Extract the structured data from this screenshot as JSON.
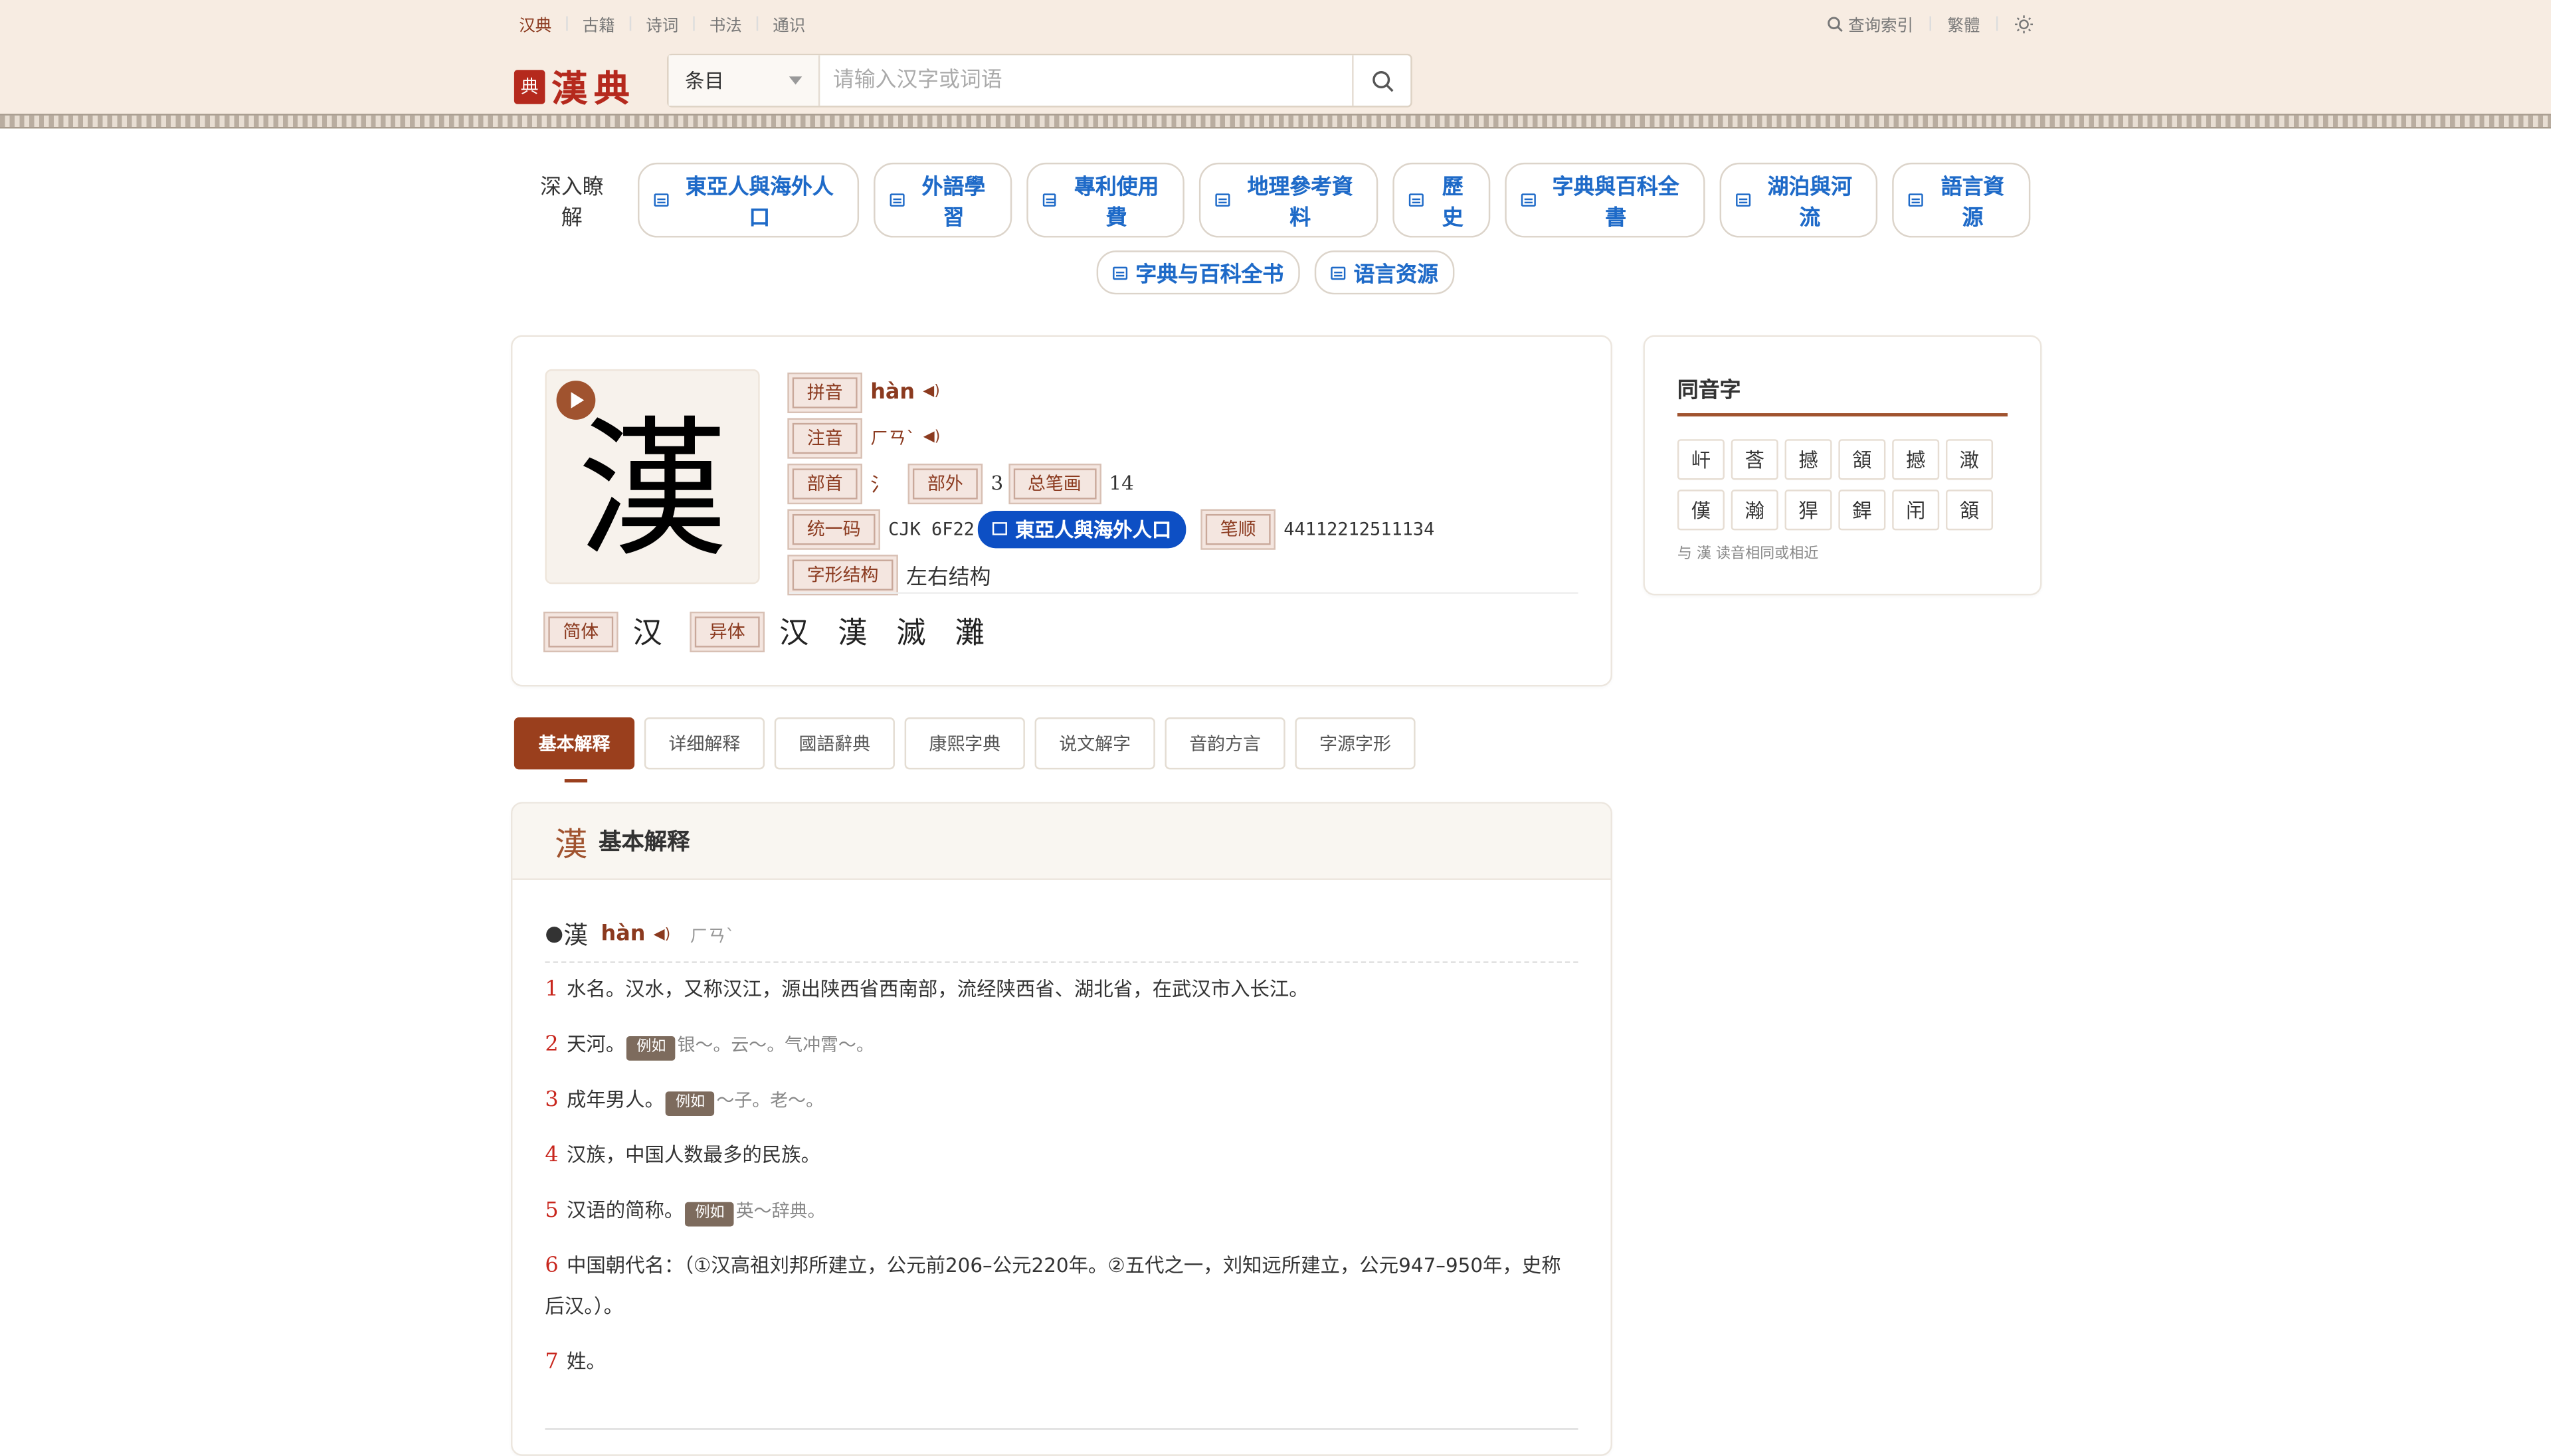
{
  "topnav": {
    "items": [
      {
        "label": "汉典"
      },
      {
        "label": "古籍"
      },
      {
        "label": "诗词"
      },
      {
        "label": "书法"
      },
      {
        "label": "通识"
      }
    ],
    "index_label": "查询索引",
    "trad_label": "繁體"
  },
  "logo": {
    "seal": "典",
    "text": "漢典"
  },
  "search": {
    "category": "条目",
    "placeholder": "请输入汉字或词语"
  },
  "explore": {
    "label": "深入瞭解",
    "tags": [
      "東亞人與海外人口",
      "外語學習",
      "專利使用費",
      "地理參考資料",
      "歷史",
      "字典與百科全書",
      "湖泊與河流",
      "語言資源"
    ],
    "tags2": [
      "字典与百科全书",
      "语言资源"
    ]
  },
  "char": {
    "glyph": "漢",
    "pinyin_label": "拼音",
    "pinyin": "hàn",
    "zhuyin_label": "注音",
    "zhuyin": "ㄏㄢˋ",
    "radical_label": "部首",
    "radical": "氵",
    "outer_label": "部外",
    "outer": "3",
    "strokes_label": "总笔画",
    "strokes": "14",
    "unicode_label": "统一码",
    "unicode": "CJK 6F22",
    "pill": "東亞人與海外人口",
    "order_label": "笔顺",
    "order": "44112212511134",
    "structure_label": "字形结构",
    "structure": "左右结构",
    "simplified_label": "简体",
    "simplified": "汉",
    "variant_label": "异体",
    "variants": [
      "汉",
      "漢",
      "滅",
      "灘"
    ]
  },
  "homophones": {
    "title": "同音字",
    "chars": [
      "屽",
      "莟",
      "撼",
      "頷",
      "撼",
      "澉",
      "傼",
      "瀚",
      "猂",
      "銲",
      "闬",
      "頷"
    ],
    "note": "与 漢 读音相同或相近"
  },
  "tabs": [
    "基本解释",
    "详细解释",
    "國語辭典",
    "康熙字典",
    "说文解字",
    "音韵方言",
    "字源字形"
  ],
  "basic": {
    "header_char": "漢",
    "header_title": "基本解释",
    "entry_char": "漢",
    "entry_pinyin": "hàn",
    "entry_zhuyin": "ㄏㄢˋ",
    "example_label": "例如",
    "defs": [
      {
        "num": "1",
        "text": "水名。汉水，又称汉江，源出陕西省西南部，流经陕西省、湖北省，在武汉市入长江。",
        "example": ""
      },
      {
        "num": "2",
        "text": "天河。",
        "example": "银～。云～。气冲霄～。"
      },
      {
        "num": "3",
        "text": "成年男人。",
        "example": "～子。老～。"
      },
      {
        "num": "4",
        "text": "汉族，中国人数最多的民族。",
        "example": ""
      },
      {
        "num": "5",
        "text": "汉语的简称。",
        "example": "英～辞典。"
      },
      {
        "num": "6",
        "text": "中国朝代名：（①汉高祖刘邦所建立，公元前206–公元220年。②五代之一，刘知远所建立，公元947–950年，史称后汉。）。",
        "example": ""
      },
      {
        "num": "7",
        "text": "姓。",
        "example": ""
      }
    ]
  }
}
